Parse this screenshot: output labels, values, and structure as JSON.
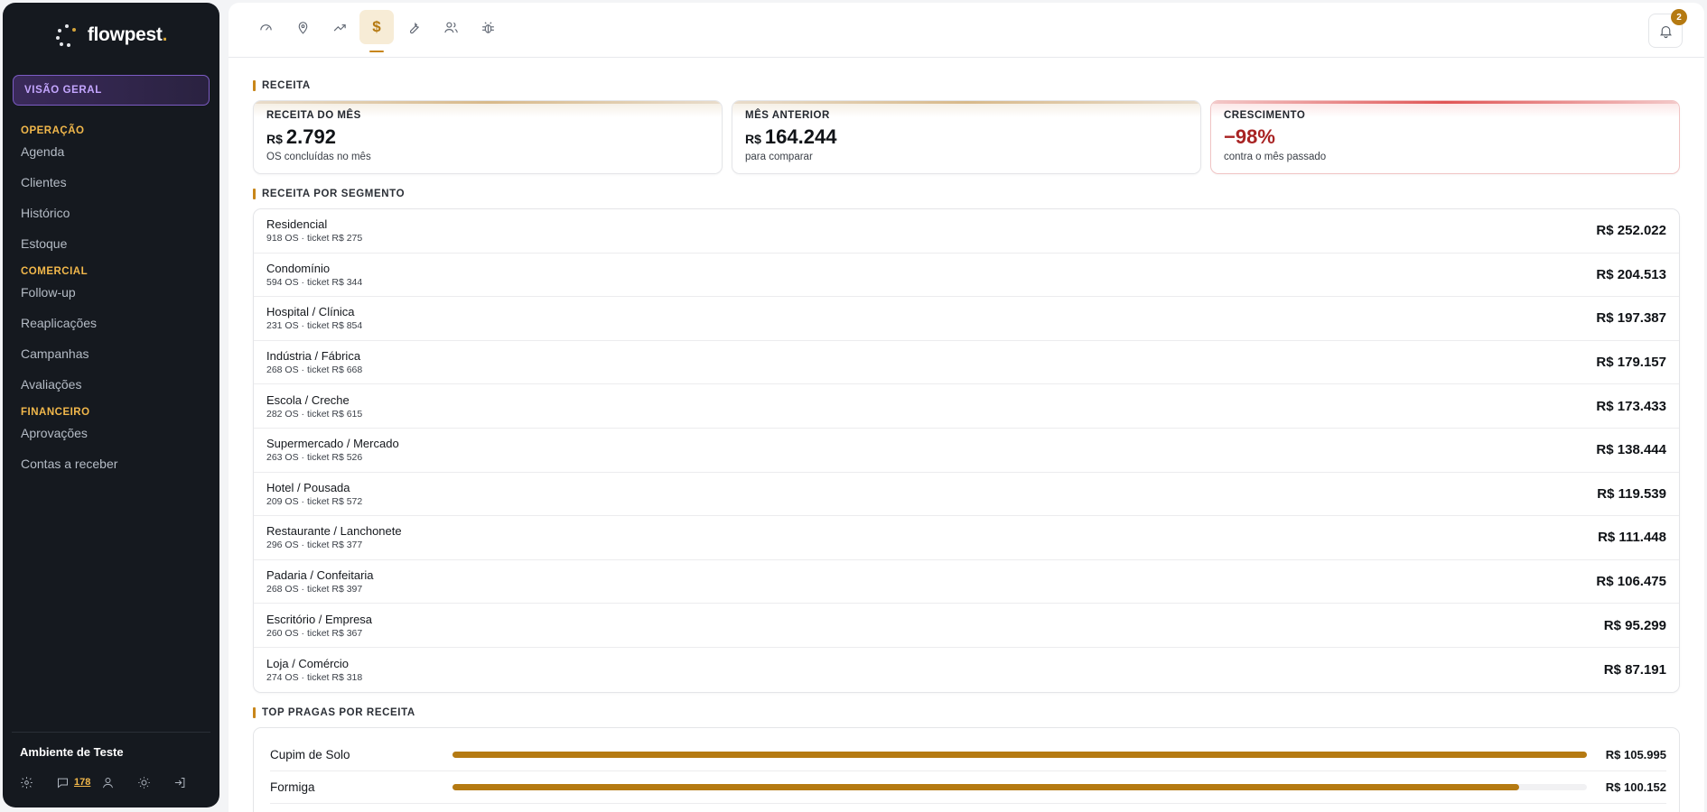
{
  "brand": {
    "name": "flowpest",
    "dot": "."
  },
  "sidebar": {
    "overview_label": "VISÃO GERAL",
    "sections": [
      {
        "title": "OPERAÇÃO",
        "items": [
          "Agenda",
          "Clientes",
          "Histórico",
          "Estoque"
        ]
      },
      {
        "title": "COMERCIAL",
        "items": [
          "Follow-up",
          "Reaplicações",
          "Campanhas",
          "Avaliações"
        ]
      },
      {
        "title": "FINANCEIRO",
        "items": [
          "Aprovações",
          "Contas a receber"
        ]
      }
    ],
    "footer": {
      "environment": "Ambiente de Teste",
      "message_count": "178",
      "icons": [
        "settings-icon",
        "chat-icon",
        "user-icon",
        "sun-icon",
        "logout-icon"
      ]
    }
  },
  "topbar": {
    "tabs": [
      "gauge-icon",
      "map-pin-icon",
      "trend-icon",
      "dollar-icon",
      "wrench-icon",
      "users-icon",
      "bug-icon"
    ],
    "active_tab": "dollar-icon",
    "notifications": "2"
  },
  "revenue": {
    "title": "RECEITA",
    "kpis": [
      {
        "label": "RECEITA DO MÊS",
        "currency": "R$",
        "value": "2.792",
        "sub": "OS concluídas no mês"
      },
      {
        "label": "MÊS ANTERIOR",
        "currency": "R$",
        "value": "164.244",
        "sub": "para comparar"
      },
      {
        "label": "CRESCIMENTO",
        "currency": "",
        "value": "−98%",
        "sub": "contra o mês passado"
      }
    ]
  },
  "segments": {
    "title": "RECEITA POR SEGMENTO",
    "rows": [
      {
        "name": "Residencial",
        "meta": "918 OS · ticket R$ 275",
        "value": "R$ 252.022"
      },
      {
        "name": "Condomínio",
        "meta": "594 OS · ticket R$ 344",
        "value": "R$ 204.513"
      },
      {
        "name": "Hospital / Clínica",
        "meta": "231 OS · ticket R$ 854",
        "value": "R$ 197.387"
      },
      {
        "name": "Indústria / Fábrica",
        "meta": "268 OS · ticket R$ 668",
        "value": "R$ 179.157"
      },
      {
        "name": "Escola / Creche",
        "meta": "282 OS · ticket R$ 615",
        "value": "R$ 173.433"
      },
      {
        "name": "Supermercado / Mercado",
        "meta": "263 OS · ticket R$ 526",
        "value": "R$ 138.444"
      },
      {
        "name": "Hotel / Pousada",
        "meta": "209 OS · ticket R$ 572",
        "value": "R$ 119.539"
      },
      {
        "name": "Restaurante / Lanchonete",
        "meta": "296 OS · ticket R$ 377",
        "value": "R$ 111.448"
      },
      {
        "name": "Padaria / Confeitaria",
        "meta": "268 OS · ticket R$ 397",
        "value": "R$ 106.475"
      },
      {
        "name": "Escritório / Empresa",
        "meta": "260 OS · ticket R$ 367",
        "value": "R$ 95.299"
      },
      {
        "name": "Loja / Comércio",
        "meta": "274 OS · ticket R$ 318",
        "value": "R$ 87.191"
      }
    ]
  },
  "pests": {
    "title": "TOP PRAGAS POR RECEITA",
    "rows": [
      {
        "name": "Cupim de Solo",
        "value": "R$ 105.995",
        "share": 1.0
      },
      {
        "name": "Formiga",
        "value": "R$ 100.152",
        "share": 0.94
      }
    ]
  },
  "colors": {
    "accent": "#b57a12",
    "sidebar_bg": "#15191f",
    "section_title": "#f2b84b",
    "negative": "#a82323"
  }
}
